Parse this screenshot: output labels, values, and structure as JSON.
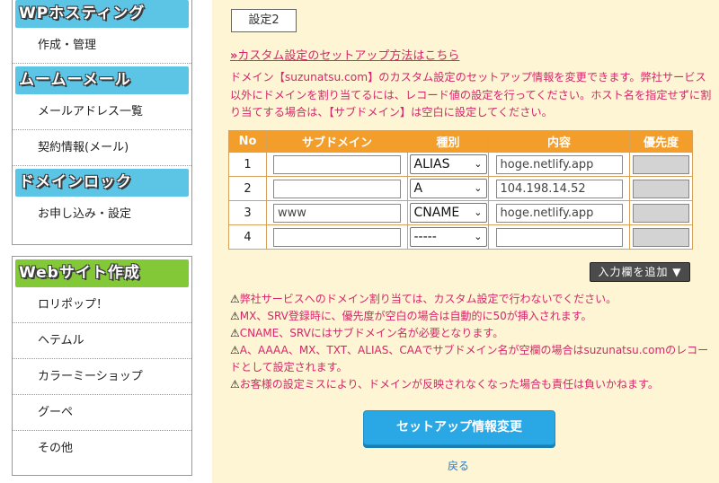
{
  "sidebar": {
    "box1": {
      "sections": [
        {
          "title": "WPホスティング",
          "items": [
            "作成・管理"
          ]
        },
        {
          "title": "ムームーメール",
          "items": [
            "メールアドレス一覧",
            "契約情報(メール)"
          ]
        },
        {
          "title": "ドメインロック",
          "items": [
            "お申し込み・設定"
          ]
        }
      ]
    },
    "box2": {
      "title": "Webサイト作成",
      "items": [
        "ロリポップ！",
        "ヘテムル",
        "カラーミーショップ",
        "グーペ",
        "その他"
      ]
    }
  },
  "main": {
    "tab_label": "設定2",
    "help_link": "カスタム設定のセットアップ方法はこちら",
    "help_arrow": "»",
    "description": "ドメイン【suzunatsu.com】のカスタム設定のセットアップ情報を変更できます。弊社サービス以外にドメインを割り当てるには、レコード値の設定を行ってください。ホスト名を指定せずに割り当てする場合は、【サブドメイン】は空白に設定してください。",
    "table": {
      "headers": [
        "No",
        "サブドメイン",
        "種別",
        "内容",
        "優先度"
      ],
      "rows": [
        {
          "no": "1",
          "subdomain": "",
          "type": "ALIAS",
          "content": "hoge.netlify.app",
          "priority": ""
        },
        {
          "no": "2",
          "subdomain": "",
          "type": "A",
          "content": "104.198.14.52",
          "priority": ""
        },
        {
          "no": "3",
          "subdomain": "www",
          "type": "CNAME",
          "content": "hoge.netlify.app",
          "priority": ""
        },
        {
          "no": "4",
          "subdomain": "",
          "type": "-----",
          "content": "",
          "priority": ""
        }
      ]
    },
    "add_button": "入力欄を追加 ▼",
    "warning_icon": "⚠",
    "notes": [
      "弊社サービスへのドメイン割り当ては、カスタム設定で行わないでください。",
      "MX、SRV登録時に、優先度が空白の場合は自動的に50が挿入されます。",
      "CNAME、SRVにはサブドメイン名が必要となります。",
      "A、AAAA、MX、TXT、ALIAS、CAAでサブドメイン名が空欄の場合はsuzunatsu.comのレコードとして設定されます。",
      "お客様の設定ミスにより、ドメインが反映されなくなった場合も責任は負いかねます。"
    ],
    "submit_button": "セットアップ情報変更",
    "back_link": "戻る"
  },
  "colors": {
    "background": "#fdf5d3",
    "accent_pink": "#d6266b",
    "table_header": "#f39e2b",
    "button_blue": "#2aa7e5",
    "sidebar_blue": "#5cc5e6",
    "sidebar_green": "#83c837"
  }
}
